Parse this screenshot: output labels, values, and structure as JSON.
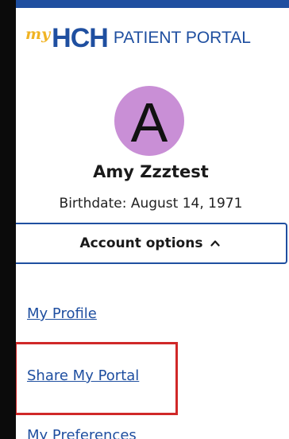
{
  "brand": {
    "my": "my",
    "hch": "HCH",
    "portal": "PATIENT PORTAL"
  },
  "user": {
    "avatar_letter": "A",
    "name": "Amy Zzztest",
    "birthdate": "Birthdate: August 14, 1971"
  },
  "account_menu": {
    "label": "Account options",
    "icon": "chevron-up-icon"
  },
  "links": {
    "profile": "My Profile",
    "share": "Share My Portal",
    "preferences": "My Preferences"
  },
  "colors": {
    "brand_blue": "#1f4fa0",
    "brand_gold": "#f0b323",
    "avatar": "#c98fd6",
    "highlight": "#d02828"
  }
}
